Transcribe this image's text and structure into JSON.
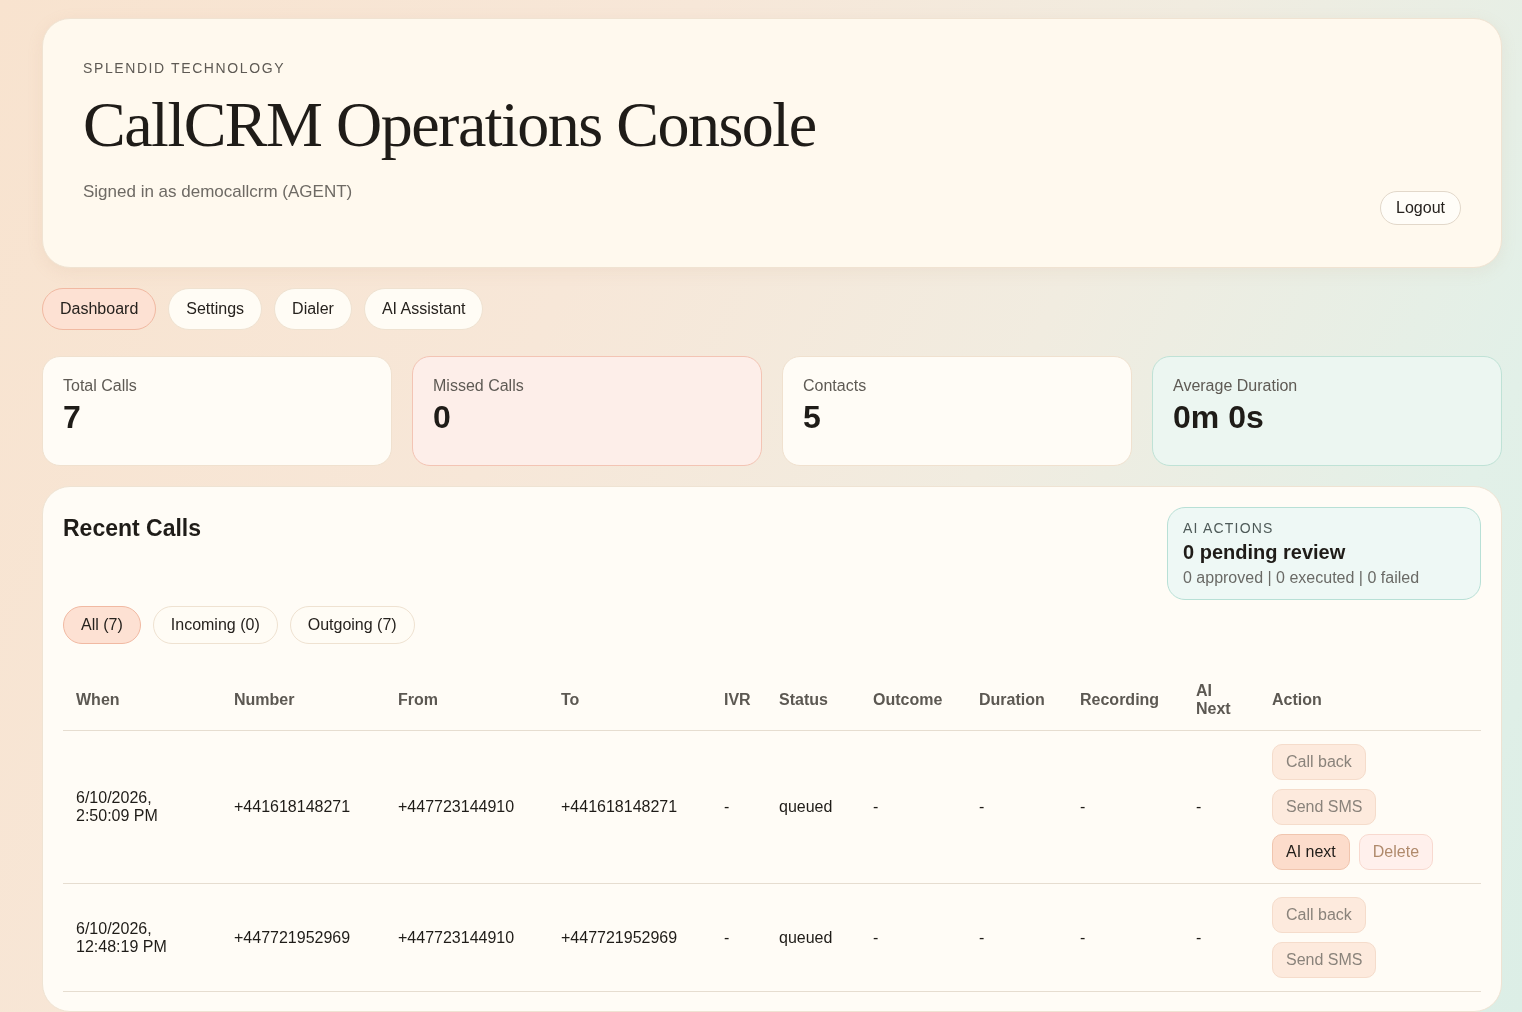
{
  "header": {
    "eyebrow": "SPLENDID TECHNOLOGY",
    "title": "CallCRM Operations Console",
    "signed_in": "Signed in as democallcrm (AGENT)",
    "logout": "Logout"
  },
  "nav": [
    {
      "label": "Dashboard",
      "selected": true
    },
    {
      "label": "Settings",
      "selected": false
    },
    {
      "label": "Dialer",
      "selected": false
    },
    {
      "label": "AI Assistant",
      "selected": false
    }
  ],
  "stats": [
    {
      "label": "Total Calls",
      "value": "7",
      "kind": "plain"
    },
    {
      "label": "Missed Calls",
      "value": "0",
      "kind": "alert"
    },
    {
      "label": "Contacts",
      "value": "5",
      "kind": "plain"
    },
    {
      "label": "Average Duration",
      "value": "0m 0s",
      "kind": "accent"
    }
  ],
  "recent_calls": {
    "title": "Recent Calls",
    "ai_actions": {
      "eyebrow": "AI ACTIONS",
      "headline": "0 pending review",
      "summary": "0 approved | 0 executed | 0 failed"
    },
    "filters": [
      {
        "label": "All (7)",
        "selected": true
      },
      {
        "label": "Incoming (0)",
        "selected": false
      },
      {
        "label": "Outgoing (7)",
        "selected": false
      }
    ],
    "table": {
      "columns": [
        "When",
        "Number",
        "From",
        "To",
        "IVR",
        "Status",
        "Outcome",
        "Duration",
        "Recording",
        "AI Next",
        "Action"
      ],
      "rows": [
        {
          "cells": [
            "6/10/2026, 2:50:09 PM",
            "+441618148271",
            "+447723144910",
            "+441618148271",
            "-",
            "queued",
            "-",
            "-",
            "-",
            "-"
          ],
          "actions": [
            {
              "label": "Call back",
              "kind": "soft",
              "disabled": true
            },
            {
              "label": "Send SMS",
              "kind": "soft",
              "disabled": true
            },
            {
              "label": "AI next",
              "kind": "primary",
              "disabled": false
            },
            {
              "label": "Delete",
              "kind": "danger",
              "disabled": false
            }
          ]
        },
        {
          "cells": [
            "6/10/2026, 12:48:19 PM",
            "+447721952969",
            "+447723144910",
            "+447721952969",
            "-",
            "queued",
            "-",
            "-",
            "-",
            "-"
          ],
          "actions": [
            {
              "label": "Call back",
              "kind": "soft",
              "disabled": true
            },
            {
              "label": "Send SMS",
              "kind": "soft",
              "disabled": true
            }
          ]
        }
      ]
    }
  }
}
